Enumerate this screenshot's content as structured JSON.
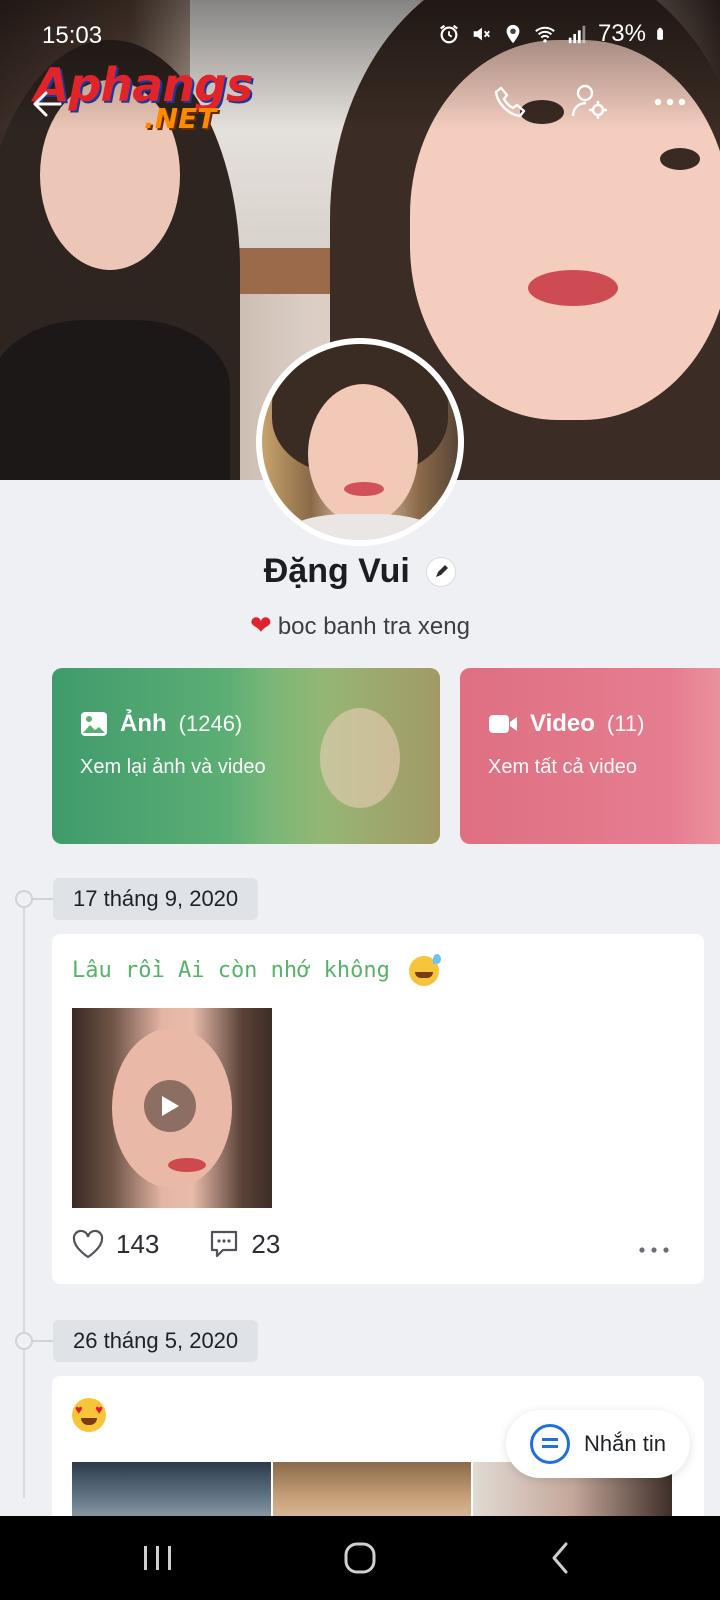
{
  "status_bar": {
    "time": "15:03",
    "battery": "73%",
    "icons": [
      "alarm-icon",
      "mute-icon",
      "location-icon",
      "wifi-icon",
      "signal-icon",
      "battery-icon"
    ]
  },
  "watermark": {
    "line1": "Aphangs",
    "line2": ".NET"
  },
  "profile": {
    "name": "Đặng Vui",
    "bio": "boc banh tra xeng"
  },
  "media_cards": {
    "photos": {
      "title": "Ảnh",
      "count": "(1246)",
      "subtitle": "Xem lại ảnh và video"
    },
    "videos": {
      "title": "Video",
      "count": "(11)",
      "subtitle": "Xem tất cả video"
    }
  },
  "timeline": {
    "posts": [
      {
        "date": "17 tháng 9, 2020",
        "caption": "Lâu rồi Ai còn nhớ không",
        "likes": "143",
        "comments": "23"
      },
      {
        "date": "26 tháng 5, 2020"
      }
    ]
  },
  "message_button": {
    "label": "Nhắn tin"
  },
  "colors": {
    "photo_card": "#3f9b6c",
    "video_card": "#df6f82",
    "caption_green": "#55b36a",
    "accent_blue": "#1f6fe0"
  }
}
